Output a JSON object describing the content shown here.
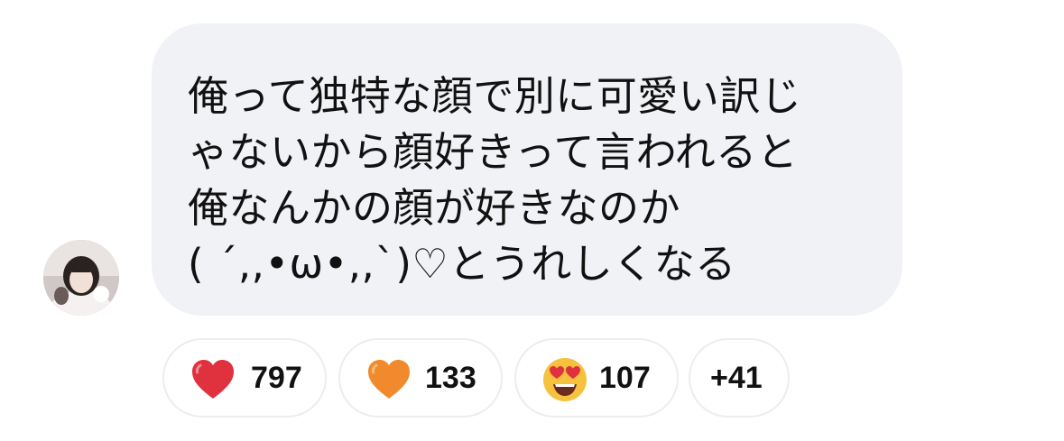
{
  "message": {
    "lines": [
      "俺って独特な顔で別に可愛い訳じ",
      "ゃないから顔好きって言われると",
      "俺なんかの顔が好きなのか",
      "( ´,,•ω•,,`)♡とうれしくなる"
    ]
  },
  "reactions": [
    {
      "icon": "red-heart-icon",
      "count": "797"
    },
    {
      "icon": "orange-heart-icon",
      "count": "133"
    },
    {
      "icon": "heart-eyes-face-icon",
      "count": "107"
    },
    {
      "label": "+41"
    }
  ],
  "colors": {
    "bubble_bg": "#f1f2f6",
    "red_heart": "#e0313f",
    "orange_heart": "#f08a2c",
    "emoji_face": "#f6c13d",
    "pill_border": "#ecedf1"
  }
}
